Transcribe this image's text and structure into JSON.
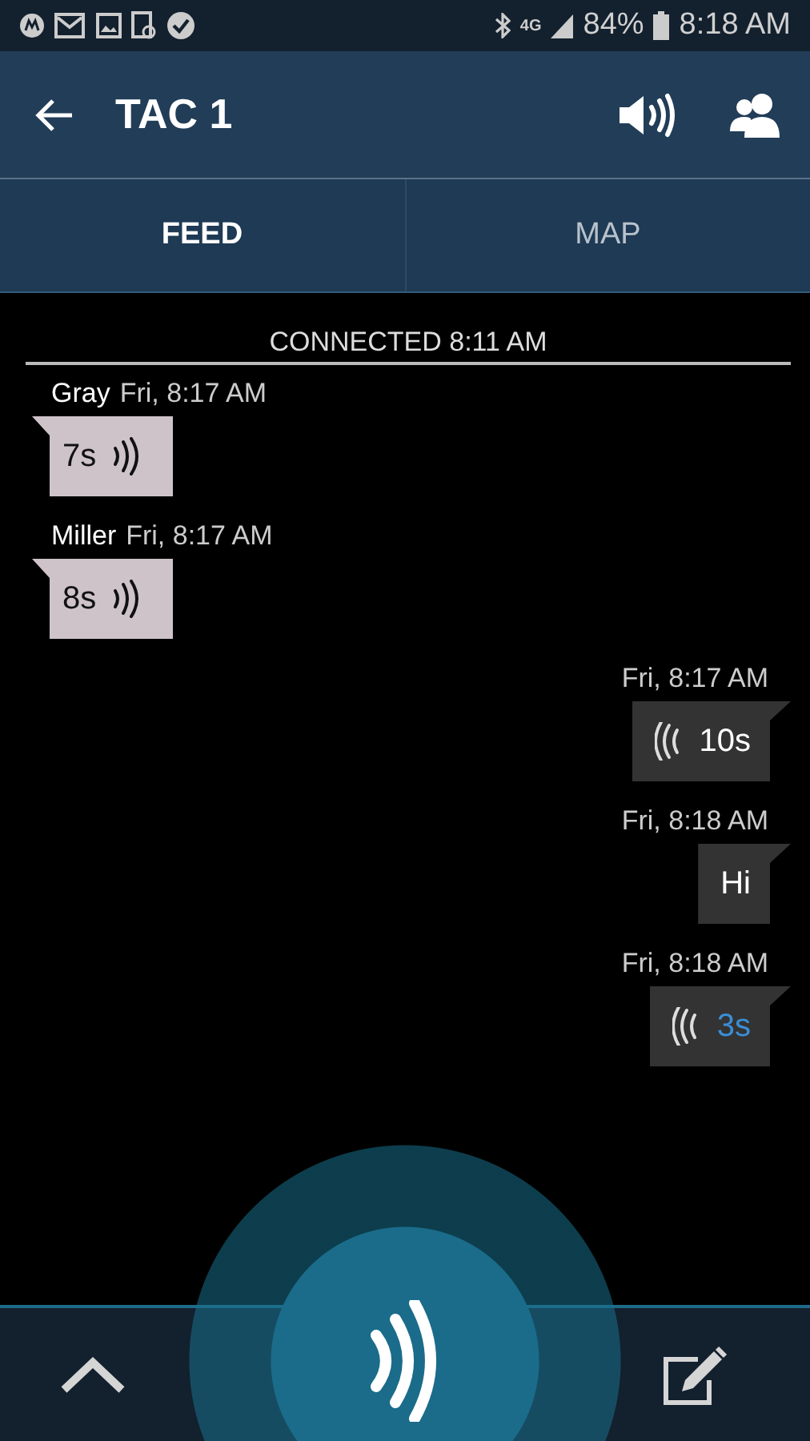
{
  "status_bar": {
    "network": "4G",
    "battery": "84%",
    "time": "8:18 AM"
  },
  "app_bar": {
    "title": "TAC 1"
  },
  "tabs": [
    {
      "label": "FEED",
      "selected": true
    },
    {
      "label": "MAP",
      "selected": false
    }
  ],
  "feed": {
    "banner": "CONNECTED 8:11 AM",
    "messages": [
      {
        "outgoing": false,
        "sender": "Gray",
        "time": "Fri, 8:17 AM",
        "kind": "voice",
        "text": "7s",
        "playing": false
      },
      {
        "outgoing": false,
        "sender": "Miller",
        "time": "Fri, 8:17 AM",
        "kind": "voice",
        "text": "8s",
        "playing": false
      },
      {
        "outgoing": true,
        "time": "Fri, 8:17 AM",
        "kind": "voice",
        "text": "10s",
        "playing": false
      },
      {
        "outgoing": true,
        "time": "Fri, 8:18 AM",
        "kind": "text",
        "text": "Hi"
      },
      {
        "outgoing": true,
        "time": "Fri, 8:18 AM",
        "kind": "voice",
        "text": "3s",
        "playing": true
      }
    ]
  }
}
